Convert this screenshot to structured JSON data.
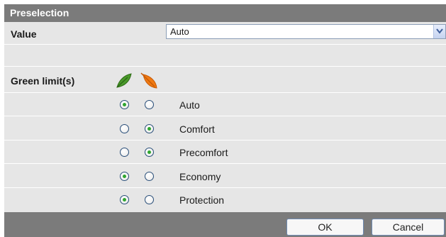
{
  "dialog": {
    "title": "Preselection",
    "value_label": "Value",
    "value_selected": "Auto",
    "green_limits_label": "Green limit(s)",
    "icons": [
      "leaf-green-icon",
      "leaf-orange-icon"
    ],
    "options": [
      {
        "label": "Auto",
        "green_selected": true,
        "orange_selected": false
      },
      {
        "label": "Comfort",
        "green_selected": false,
        "orange_selected": true
      },
      {
        "label": "Precomfort",
        "green_selected": false,
        "orange_selected": true
      },
      {
        "label": "Economy",
        "green_selected": true,
        "orange_selected": false
      },
      {
        "label": "Protection",
        "green_selected": true,
        "orange_selected": false
      }
    ],
    "ok_label": "OK",
    "cancel_label": "Cancel"
  },
  "colors": {
    "header_bg": "#7b7b7b",
    "row_bg": "#e6e6e6",
    "leaf_green": "#4a9a2a",
    "leaf_orange": "#f07a12",
    "radio_dot": "#2fa52f"
  }
}
